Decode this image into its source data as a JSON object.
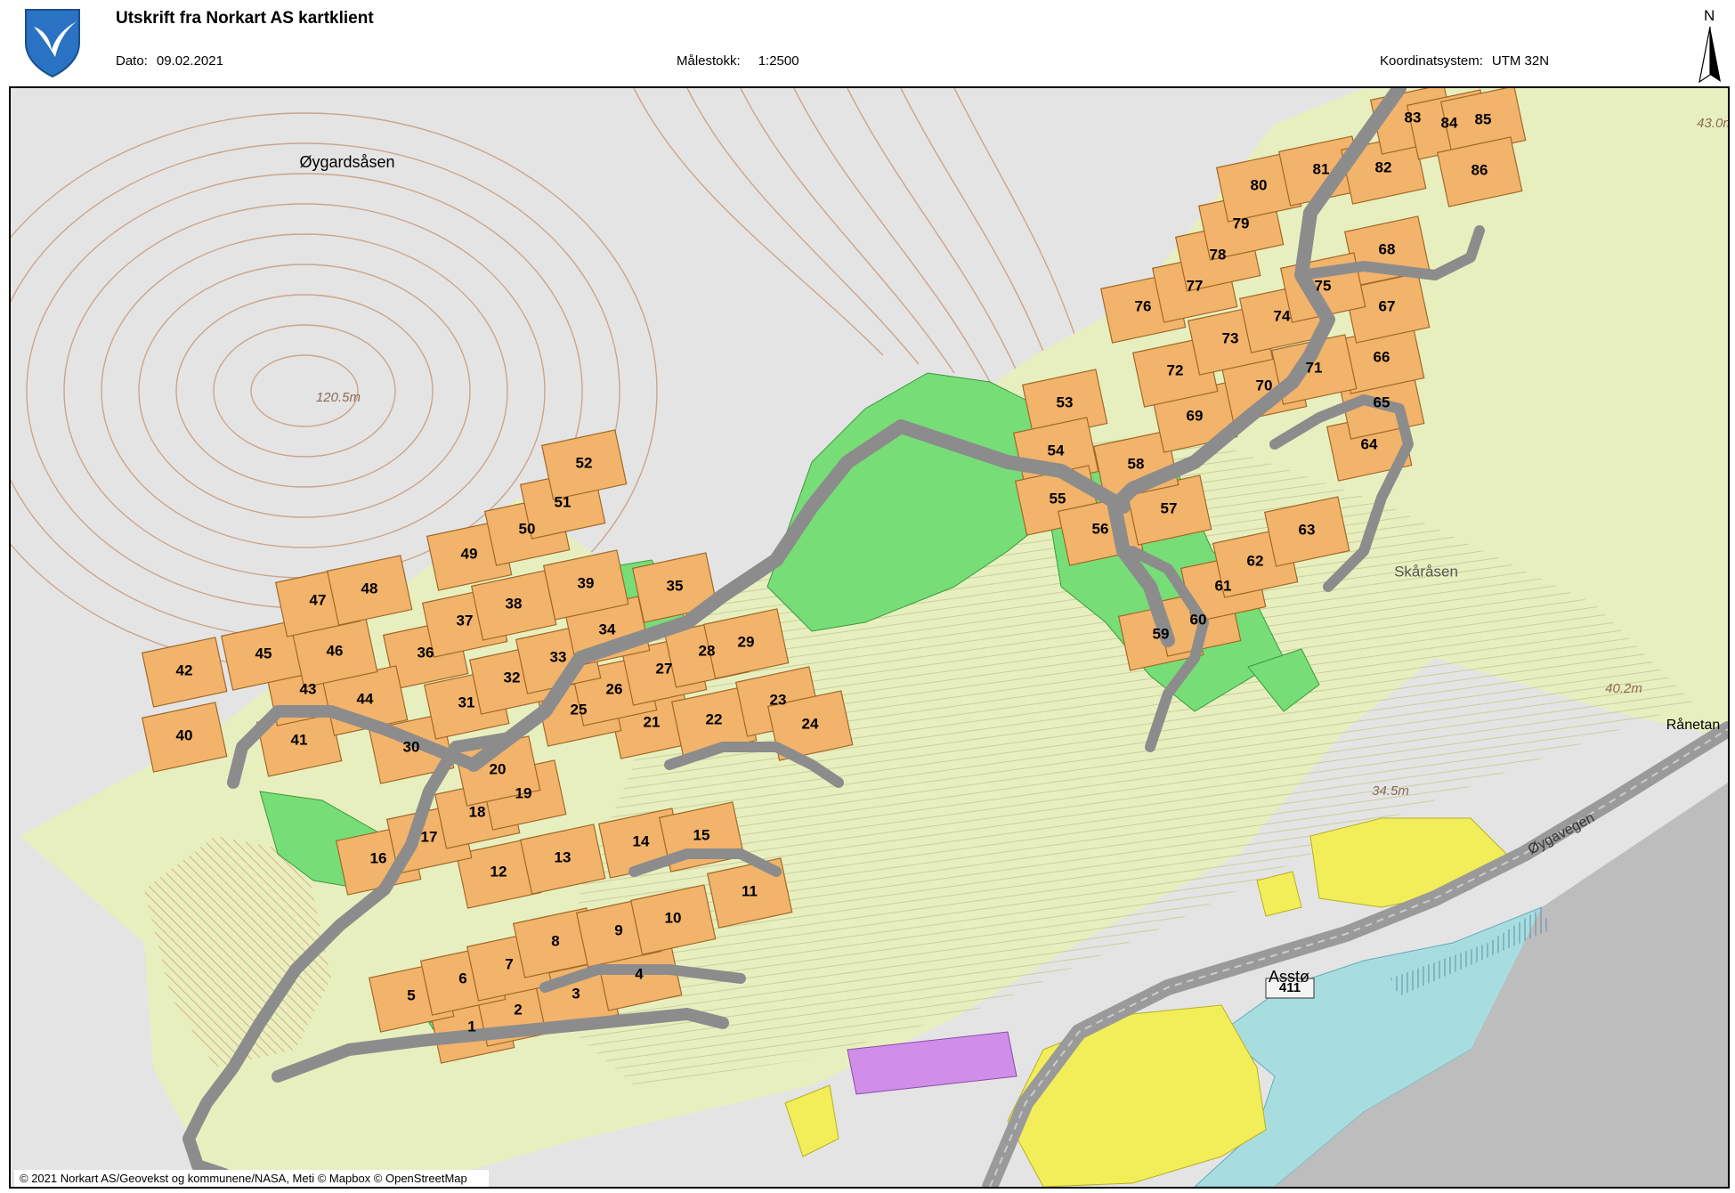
{
  "header": {
    "title": "Utskrift fra Norkart AS kartklient",
    "date_label": "Dato:",
    "date_value": "09.02.2021",
    "scale_label": "Målestokk:",
    "scale_value": "1:2500",
    "crs_label": "Koordinatsystem:",
    "crs_value": "UTM 32N",
    "north_label": "N"
  },
  "map": {
    "place_names": [
      "Øygardsåsen",
      "Skåråsen",
      "Asstø",
      "Rånetan"
    ],
    "road_name": "Øygavegen",
    "road_number": "411",
    "elevations": [
      "120.5m",
      "43.0m",
      "40.2m",
      "34.5m"
    ],
    "plot_numbers": [
      "1",
      "2",
      "3",
      "4",
      "5",
      "6",
      "7",
      "8",
      "9",
      "10",
      "11",
      "12",
      "13",
      "14",
      "15",
      "16",
      "17",
      "18",
      "19",
      "20",
      "21",
      "22",
      "23",
      "24",
      "25",
      "26",
      "27",
      "28",
      "29",
      "30",
      "31",
      "32",
      "33",
      "34",
      "35",
      "36",
      "37",
      "38",
      "39",
      "40",
      "41",
      "42",
      "43",
      "44",
      "45",
      "46",
      "47",
      "48",
      "49",
      "50",
      "51",
      "52",
      "53",
      "54",
      "55",
      "56",
      "57",
      "58",
      "59",
      "60",
      "61",
      "62",
      "63",
      "64",
      "65",
      "66",
      "67",
      "68",
      "69",
      "70",
      "71",
      "72",
      "73",
      "74",
      "75",
      "76",
      "77",
      "78",
      "79",
      "80",
      "81",
      "82",
      "83",
      "84",
      "85",
      "86"
    ],
    "colors": {
      "terrain": "#e4e4e4",
      "contour": "#c9a58f",
      "zone": "#e8efbf",
      "plot": "#f2b36b",
      "plot_edge": "#a06828",
      "green": "#77dd77",
      "road": "#9c9c9c",
      "water": "#a8dde0",
      "yellow": "#f2ee5a",
      "purple": "#d08ee8"
    }
  },
  "attribution": "© 2021 Norkart AS/Geovekst og kommunene/NASA, Meti © Mapbox © OpenStreetMap"
}
